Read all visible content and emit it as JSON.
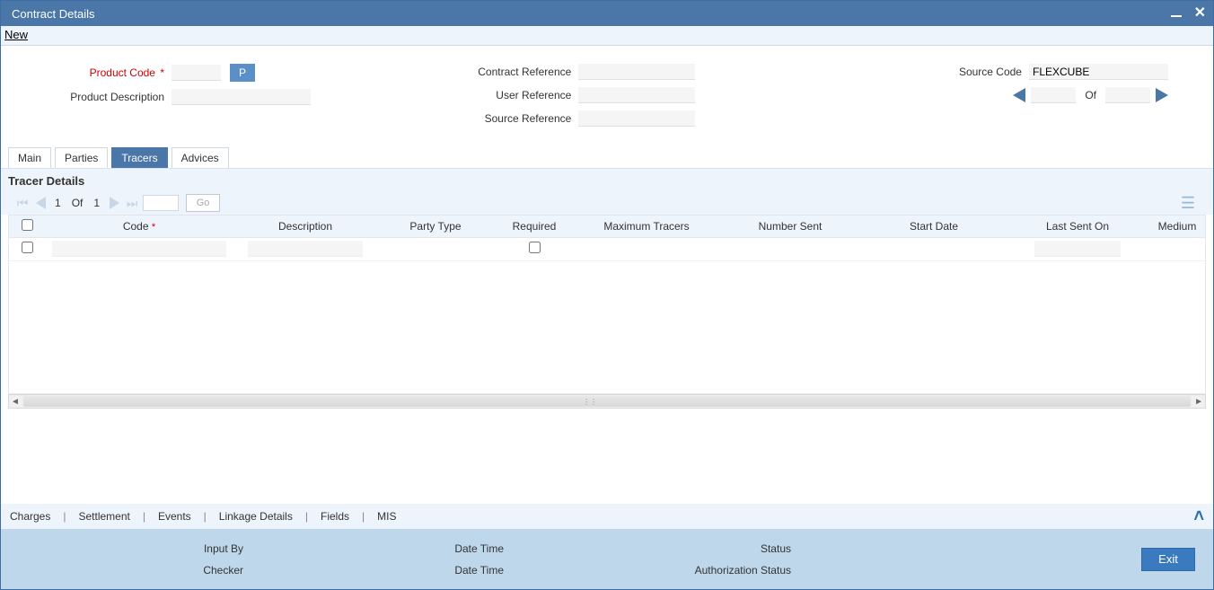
{
  "window": {
    "title": "Contract Details"
  },
  "toolbar": {
    "new_label": "New"
  },
  "header": {
    "product_code_label": "Product Code",
    "product_desc_label": "Product Description",
    "contract_ref_label": "Contract Reference",
    "user_ref_label": "User Reference",
    "source_ref_label": "Source Reference",
    "source_code_label": "Source Code",
    "source_code_value": "FLEXCUBE",
    "p_button": "P",
    "of_label": "Of"
  },
  "tabs": {
    "main": "Main",
    "parties": "Parties",
    "tracers": "Tracers",
    "advices": "Advices"
  },
  "section": {
    "tracer_details": "Tracer Details"
  },
  "table_pager": {
    "current": "1",
    "of": "Of",
    "total": "1",
    "go": "Go"
  },
  "table": {
    "columns": {
      "code": "Code",
      "description": "Description",
      "party_type": "Party Type",
      "required": "Required",
      "max_tracers": "Maximum Tracers",
      "number_sent": "Number Sent",
      "start_date": "Start Date",
      "last_sent_on": "Last Sent On",
      "medium": "Medium"
    },
    "rows": [
      {
        "code": "",
        "description": "",
        "party_type": "",
        "required": false,
        "max_tracers": "",
        "number_sent": "",
        "start_date": "",
        "last_sent_on": "",
        "medium": ""
      }
    ]
  },
  "bottom_links": {
    "charges": "Charges",
    "settlement": "Settlement",
    "events": "Events",
    "linkage": "Linkage Details",
    "fields": "Fields",
    "mis": "MIS"
  },
  "status": {
    "input_by": "Input By",
    "checker": "Checker",
    "date_time1": "Date Time",
    "date_time2": "Date Time",
    "status_label": "Status",
    "auth_status": "Authorization Status",
    "exit": "Exit"
  }
}
